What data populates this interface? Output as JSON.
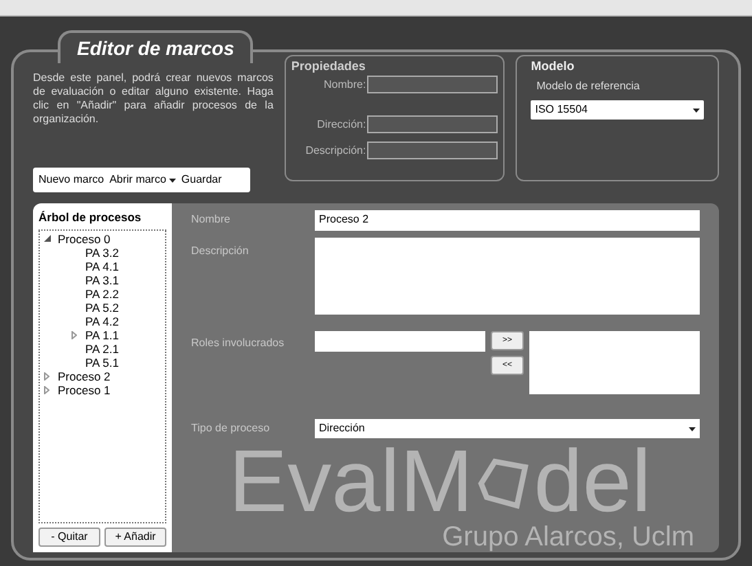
{
  "window": {
    "title": "Editor de marcos"
  },
  "intro": "Desde este panel, podrá crear nuevos marcos de evaluación o editar alguno existente. Haga clic en \"Añadir\" para añadir procesos de la organización.",
  "toolbar": [
    {
      "label": "Nuevo marco",
      "kind": "button"
    },
    {
      "label": "Abrir marco",
      "kind": "dropdown"
    },
    {
      "label": "Guardar",
      "kind": "button"
    }
  ],
  "properties": {
    "title": "Propiedades",
    "fields": [
      {
        "label": "Nombre:"
      },
      {
        "label": "Dirección:"
      },
      {
        "label": "Descripción:"
      }
    ]
  },
  "model": {
    "title": "Modelo",
    "label": "Modelo de referencia",
    "value": "ISO 15504"
  },
  "tree": {
    "title": "Árbol de procesos",
    "nodes": [
      {
        "label": "Proceso 0",
        "expandable": true,
        "expanded": true,
        "children": [
          {
            "label": "PA 3.2",
            "expandable": false
          },
          {
            "label": "PA 4.1",
            "expandable": false
          },
          {
            "label": "PA 3.1",
            "expandable": false
          },
          {
            "label": "PA 2.2",
            "expandable": false
          },
          {
            "label": "PA 5.2",
            "expandable": false
          },
          {
            "label": "PA 4.2",
            "expandable": false
          },
          {
            "label": "PA 1.1",
            "expandable": true,
            "expanded": false
          },
          {
            "label": "PA 2.1",
            "expandable": false
          },
          {
            "label": "PA 5.1",
            "expandable": false
          }
        ]
      },
      {
        "label": "Proceso 2",
        "expandable": true,
        "expanded": false
      },
      {
        "label": "Proceso 1",
        "expandable": true,
        "expanded": false
      }
    ],
    "buttons": [
      "- Quitar",
      "+ Añadir"
    ]
  },
  "form": {
    "name_label": "Nombre",
    "name_value": "Proceso 2",
    "description_label": "Descripción",
    "roles_label": "Roles involucrados",
    "add_button": ">>",
    "remove_button": "<<",
    "type_label": "Tipo de proceso",
    "type_value": "Dirección"
  },
  "branding": {
    "logo_left": "EvalM",
    "logo_right": "del",
    "subtitle": "Grupo Alarcos, Uclm"
  }
}
